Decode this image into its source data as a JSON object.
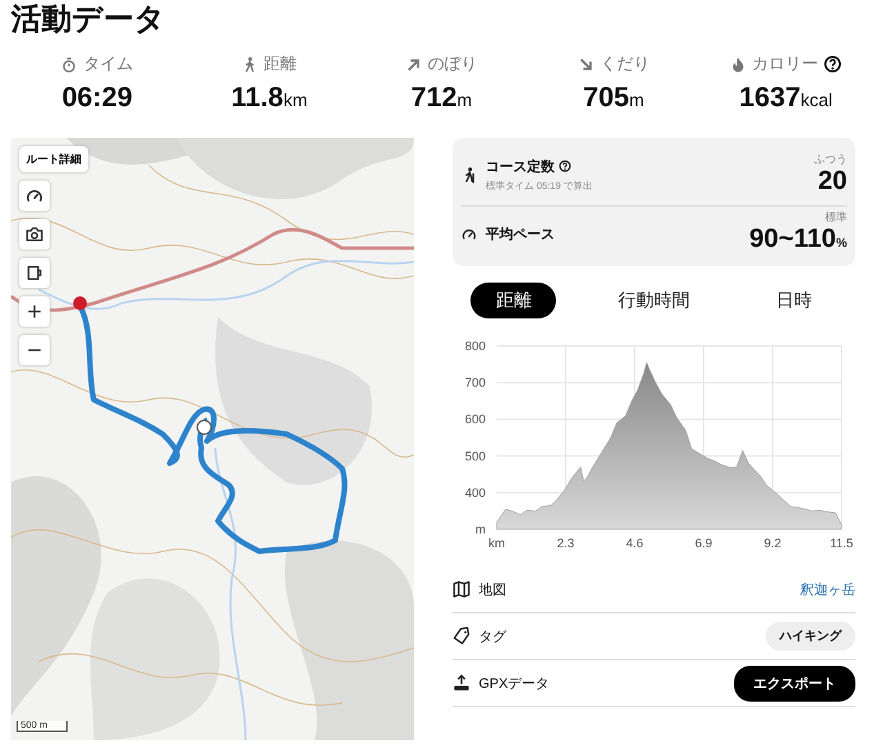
{
  "title": "活動データ",
  "stats": [
    {
      "kind": "time",
      "label": "タイム",
      "value": "06:29",
      "help": false
    },
    {
      "kind": "distance",
      "label": "距離",
      "value": "11.8",
      "unit": "km",
      "help": false
    },
    {
      "kind": "ascent",
      "label": "のぼり",
      "value": "712",
      "unit": "m",
      "help": false
    },
    {
      "kind": "descent",
      "label": "くだり",
      "value": "705",
      "unit": "m",
      "help": false
    },
    {
      "kind": "calories",
      "label": "カロリー",
      "value": "1637",
      "unit": "kcal",
      "help": true
    }
  ],
  "map": {
    "kind": "picture",
    "route_button": "ルート詳細",
    "scale": "500 m"
  },
  "course": {
    "label": "コース定数",
    "note": "標準タイム 05:19 で算出",
    "grade": "ふつう",
    "value": "20"
  },
  "pace": {
    "label": "平均ペース",
    "grade": "標準",
    "value": "90~110",
    "unit": "%"
  },
  "tabs": [
    {
      "label": "距離",
      "selected": true
    },
    {
      "label": "行動時間",
      "selected": false
    },
    {
      "label": "日時",
      "selected": false
    }
  ],
  "elevation": {
    "chart_data": {
      "type": "area",
      "xlabel": "km",
      "ylabel": "m",
      "ylim": [
        300,
        800
      ],
      "xlim": [
        0,
        11.5
      ],
      "x": [
        0,
        0.3,
        0.5,
        0.8,
        1.0,
        1.3,
        1.5,
        1.8,
        2.0,
        2.3,
        2.5,
        2.8,
        2.9,
        3.0,
        3.2,
        3.5,
        3.8,
        4.0,
        4.3,
        4.5,
        4.7,
        4.9,
        5.0,
        5.1,
        5.3,
        5.5,
        5.8,
        6.0,
        6.3,
        6.5,
        6.8,
        7.0,
        7.3,
        7.5,
        7.8,
        8.0,
        8.2,
        8.4,
        8.6,
        8.8,
        9.0,
        9.3,
        9.5,
        9.8,
        10.0,
        10.3,
        10.5,
        10.8,
        11.0,
        11.3,
        11.5
      ],
      "grid": true,
      "series": [
        {
          "color": "#a0a0a0",
          "values": [
            319,
            355,
            350,
            340,
            352,
            350,
            362,
            365,
            380,
            412,
            440,
            470,
            432,
            440,
            470,
            510,
            550,
            590,
            610,
            650,
            680,
            725,
            755,
            735,
            700,
            670,
            640,
            605,
            570,
            520,
            505,
            495,
            485,
            476,
            468,
            470,
            515,
            480,
            462,
            445,
            420,
            400,
            385,
            362,
            360,
            355,
            350,
            352,
            348,
            345,
            312
          ]
        }
      ],
      "xticks": [
        2.3,
        4.6,
        6.9,
        9.2,
        11.5
      ],
      "yticks": [
        400,
        500,
        600,
        700,
        800
      ]
    }
  },
  "rows": [
    {
      "kind": "map",
      "label": "地図",
      "value": "釈迦ヶ岳"
    },
    {
      "kind": "tag",
      "label": "タグ",
      "value": "ハイキング"
    },
    {
      "kind": "gpx",
      "label": "GPXデータ",
      "value": "エクスポート"
    }
  ]
}
